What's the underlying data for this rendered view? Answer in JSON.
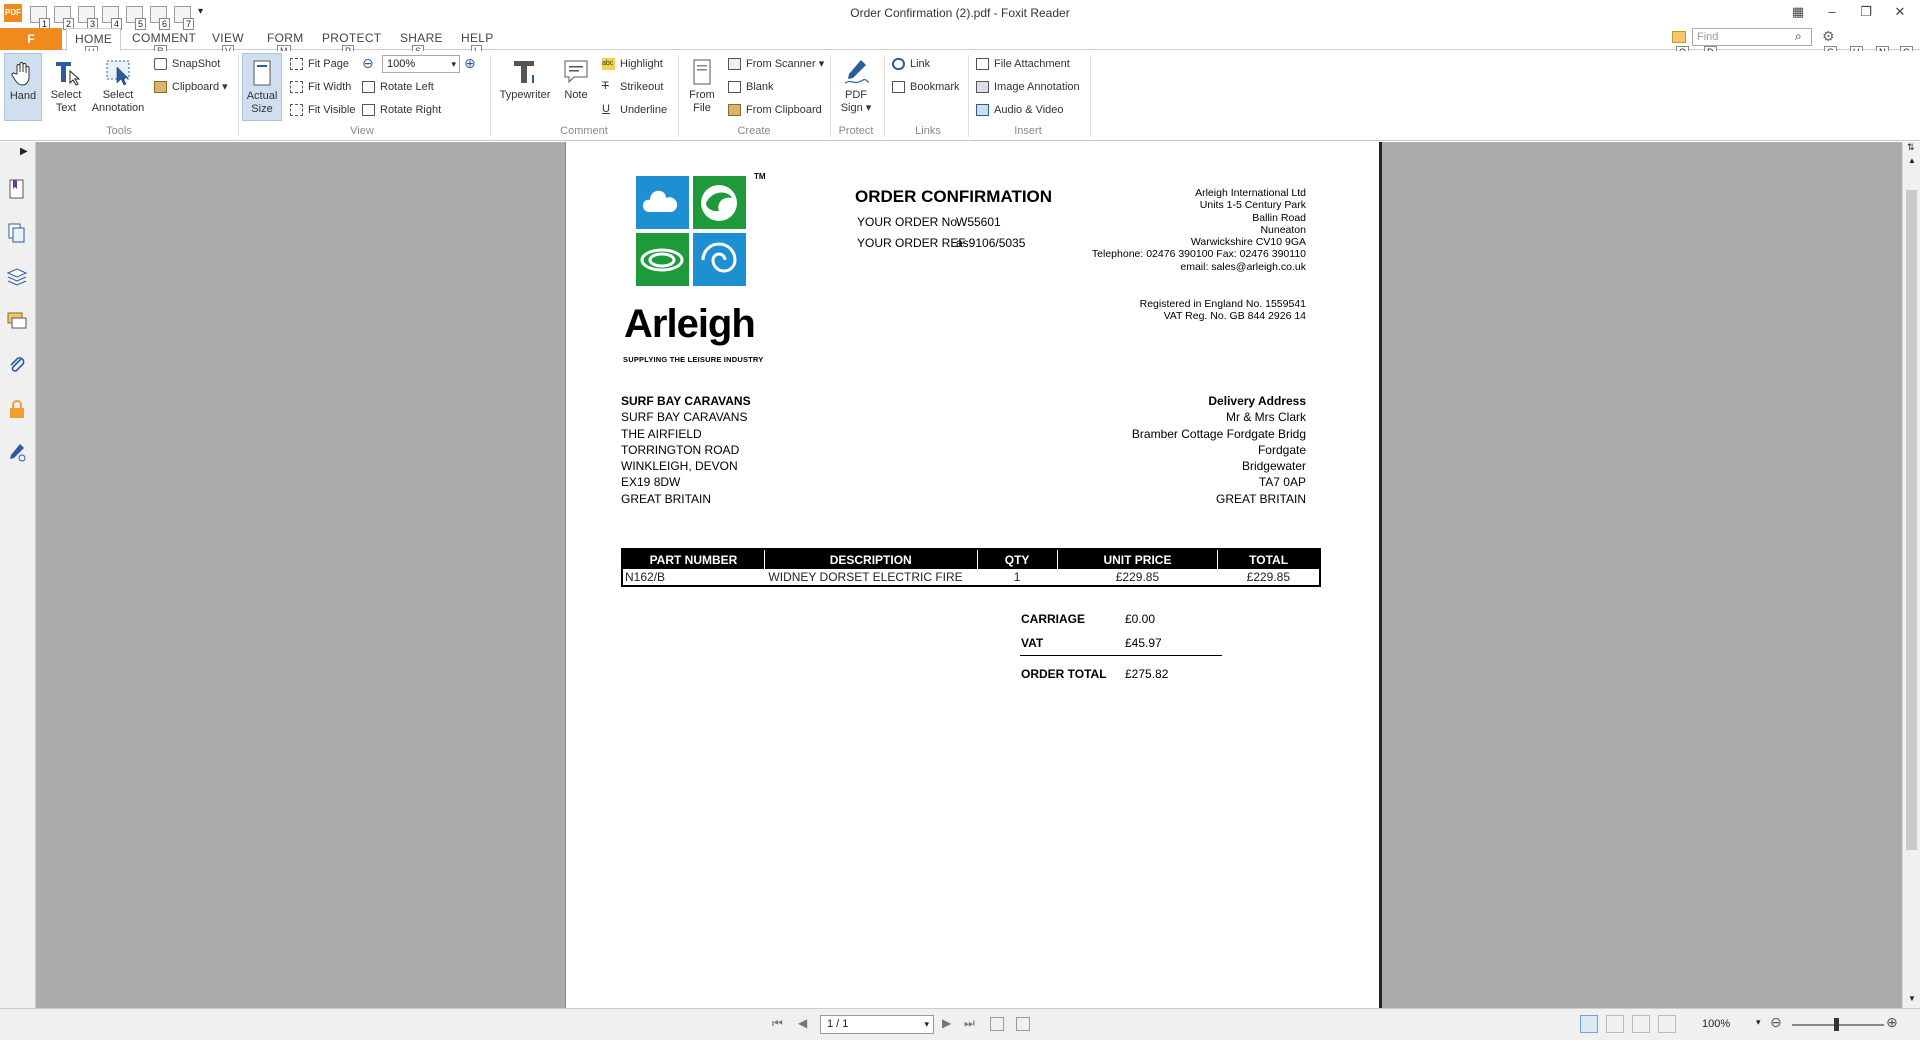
{
  "window": {
    "title": "Order Confirmation (2).pdf - Foxit Reader",
    "quick_access_keys": [
      "1",
      "2",
      "3",
      "4",
      "5",
      "6",
      "7"
    ]
  },
  "ribbon_tabs": [
    {
      "label": "F",
      "key": ""
    },
    {
      "label": "HOME",
      "key": "H"
    },
    {
      "label": "COMMENT",
      "key": "R"
    },
    {
      "label": "VIEW",
      "key": "V"
    },
    {
      "label": "FORM",
      "key": "M"
    },
    {
      "label": "PROTECT",
      "key": "P"
    },
    {
      "label": "SHARE",
      "key": "S"
    },
    {
      "label": "HELP",
      "key": "L"
    }
  ],
  "find": {
    "placeholder": "Find",
    "keys": [
      "Q",
      "D",
      "G",
      "U",
      "N",
      "C"
    ]
  },
  "ribbon": {
    "tools": {
      "hand": "Hand",
      "select_text_1": "Select",
      "select_text_2": "Text",
      "select_ann_1": "Select",
      "select_ann_2": "Annotation",
      "snapshot": "SnapShot",
      "clipboard": "Clipboard",
      "label": "Tools"
    },
    "view": {
      "actual_1": "Actual",
      "actual_2": "Size",
      "fit_page": "Fit Page",
      "fit_width": "Fit Width",
      "fit_visible": "Fit Visible",
      "zoom": "100%",
      "rotate_left": "Rotate Left",
      "rotate_right": "Rotate Right",
      "label": "View"
    },
    "comment": {
      "typewriter": "Typewriter",
      "note": "Note",
      "highlight": "Highlight",
      "strikeout": "Strikeout",
      "underline": "Underline",
      "label": "Comment"
    },
    "create": {
      "from_1": "From",
      "from_2": "File",
      "from_scanner": "From Scanner",
      "blank": "Blank",
      "from_clipboard": "From Clipboard",
      "label": "Create"
    },
    "protect": {
      "pdf_1": "PDF",
      "pdf_2": "Sign",
      "label": "Protect"
    },
    "links": {
      "link": "Link",
      "bookmark": "Bookmark",
      "label": "Links"
    },
    "insert": {
      "file_attachment": "File Attachment",
      "image_annotation": "Image Annotation",
      "audio_video": "Audio & Video",
      "label": "Insert"
    }
  },
  "document": {
    "logo_text": "Arleigh",
    "logo_tagline": "SUPPLYING THE LEISURE INDUSTRY",
    "logo_tm": "TM",
    "heading": "ORDER CONFIRMATION",
    "order_no_label": "YOUR ORDER No.",
    "order_no": "W55601",
    "order_ref_label": "YOUR ORDER REF",
    "order_ref": "as9106/5035",
    "company_lines": [
      "Arleigh International Ltd",
      "Units 1-5 Century Park",
      "Ballin Road",
      "Nuneaton",
      "Warwickshire CV10 9GA",
      "Telephone: 02476 390100 Fax: 02476 390110",
      "email: sales@arleigh.co.uk"
    ],
    "registration_lines": [
      "Registered in England No. 1559541",
      "VAT Reg. No. GB 844 2926 14"
    ],
    "customer_name": "SURF BAY CARAVANS",
    "customer_lines": [
      "SURF BAY CARAVANS",
      "THE AIRFIELD",
      "TORRINGTON ROAD",
      "WINKLEIGH, DEVON",
      "EX19 8DW",
      "GREAT BRITAIN"
    ],
    "delivery_heading": "Delivery Address",
    "delivery_lines": [
      "Mr & Mrs Clark",
      "Bramber Cottage  Fordgate  Bridg",
      "Fordgate",
      "Bridgewater",
      "TA7 0AP",
      "GREAT BRITAIN"
    ],
    "table": {
      "headers": [
        "PART NUMBER",
        "DESCRIPTION",
        "QTY",
        "UNIT PRICE",
        "TOTAL"
      ],
      "rows": [
        [
          "N162/B",
          "WIDNEY DORSET ELECTRIC FIRE",
          "1",
          "£229.85",
          "£229.85"
        ]
      ]
    },
    "totals": {
      "carriage_label": "CARRIAGE",
      "carriage": "£0.00",
      "vat_label": "VAT",
      "vat": "£45.97",
      "order_total_label": "ORDER TOTAL",
      "order_total": "£275.82"
    }
  },
  "status": {
    "page": "1 / 1",
    "zoom": "100%"
  },
  "colors": {
    "accent": "#f08a1c",
    "selected": "#cfdff0",
    "logo_blue": "#1e8fd0",
    "logo_green": "#1f9a3a"
  }
}
